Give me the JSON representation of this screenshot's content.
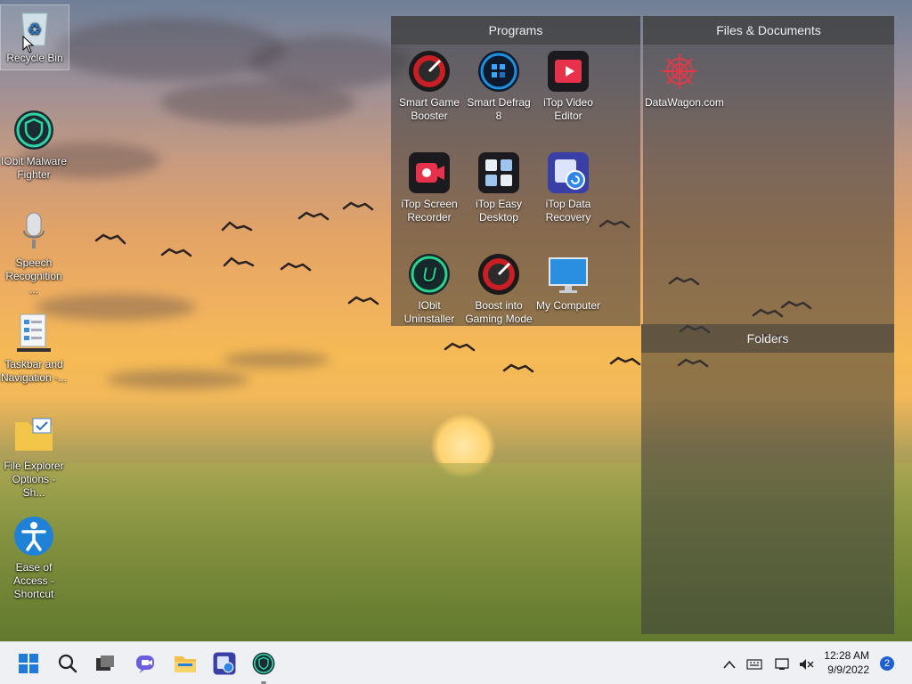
{
  "desktop": {
    "icons": [
      {
        "label": "Recycle Bin",
        "icon": "recycle-bin-icon"
      },
      {
        "label": "IObit Malware Fighter",
        "icon": "iobit-malware-fighter-icon"
      },
      {
        "label": "Speech Recognition ...",
        "icon": "microphone-icon"
      },
      {
        "label": "Taskbar and Navigation -...",
        "icon": "taskbar-settings-icon"
      },
      {
        "label": "File Explorer Options - Sh...",
        "icon": "folder-check-icon"
      },
      {
        "label": "Ease of Access - Shortcut",
        "icon": "accessibility-icon"
      }
    ]
  },
  "fences": {
    "programs": {
      "title": "Programs",
      "items": [
        {
          "label": "Smart Game Booster",
          "icon": "smart-game-booster-icon"
        },
        {
          "label": "Smart Defrag 8",
          "icon": "smart-defrag-icon"
        },
        {
          "label": "iTop Video Editor",
          "icon": "itop-video-editor-icon"
        },
        {
          "label": "iTop Screen Recorder",
          "icon": "itop-screen-recorder-icon"
        },
        {
          "label": "iTop Easy Desktop",
          "icon": "itop-easy-desktop-icon"
        },
        {
          "label": "iTop Data Recovery",
          "icon": "itop-data-recovery-icon"
        },
        {
          "label": "IObit Uninstaller",
          "icon": "iobit-uninstaller-icon"
        },
        {
          "label": "Boost into Gaming Mode",
          "icon": "gaming-mode-icon"
        },
        {
          "label": "My Computer",
          "icon": "monitor-icon"
        }
      ]
    },
    "files": {
      "title": "Files & Documents",
      "items": [
        {
          "label": "DataWagon.com",
          "icon": "datawagon-icon"
        }
      ]
    },
    "folders": {
      "title": "Folders"
    }
  },
  "taskbar": {
    "items": [
      "start-icon",
      "search-icon",
      "task-view-icon",
      "chat-icon",
      "file-explorer-icon",
      "itop-data-recovery-icon",
      "iobit-malware-fighter-icon"
    ],
    "time": "12:28 AM",
    "date": "9/9/2022",
    "notifications": "2",
    "colors": {
      "accent": "#1f5fd6",
      "taskbar": "#eef0f4"
    }
  }
}
